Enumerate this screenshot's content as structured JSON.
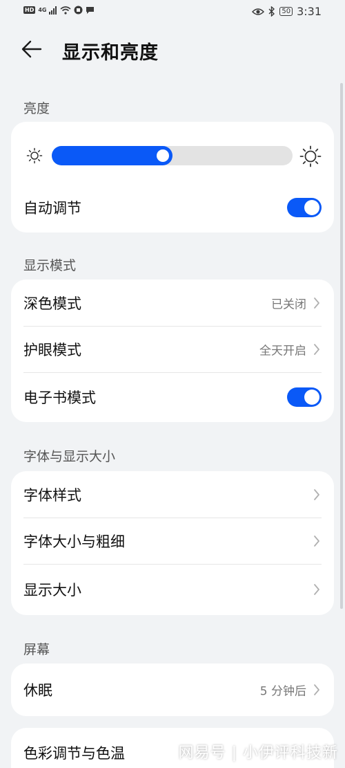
{
  "status_bar": {
    "hd_badge": "HD",
    "signal_label": "4G",
    "battery": "50",
    "time": "3:31"
  },
  "header": {
    "title": "显示和亮度"
  },
  "sections": {
    "brightness": {
      "label": "亮度",
      "level_fraction": 0.5,
      "auto_label": "自动调节",
      "auto_on": true
    },
    "display_mode": {
      "label": "显示模式",
      "dark_mode": {
        "label": "深色模式",
        "value": "已关闭"
      },
      "eye_comfort": {
        "label": "护眼模式",
        "value": "全天开启"
      },
      "ebook_mode": {
        "label": "电子书模式",
        "on": true
      }
    },
    "font_display": {
      "label": "字体与显示大小",
      "items": [
        {
          "label": "字体样式"
        },
        {
          "label": "字体大小与粗细"
        },
        {
          "label": "显示大小"
        }
      ]
    },
    "screen": {
      "label": "屏幕",
      "sleep": {
        "label": "休眠",
        "value": "5 分钟后"
      },
      "color_temp": {
        "label": "色彩调节与色温"
      }
    }
  },
  "colors": {
    "accent": "#0a59f7",
    "background": "#f1f3f5",
    "card": "#ffffff"
  },
  "icons": [
    "back-arrow-icon",
    "sun-small-icon",
    "sun-large-icon",
    "chevron-right-icon",
    "eye-icon",
    "bluetooth-icon",
    "wifi-icon"
  ],
  "watermark": "网易号 | 小伊评科技新"
}
